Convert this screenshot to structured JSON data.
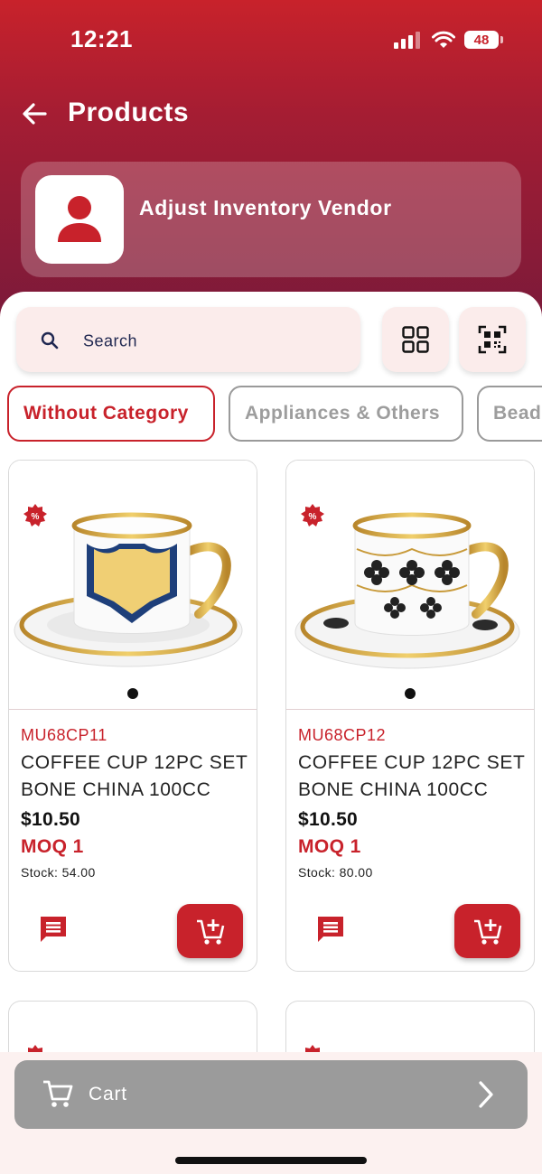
{
  "status": {
    "time": "12:21",
    "battery": "48"
  },
  "header": {
    "title": "Products",
    "back_icon": "arrow-left-icon"
  },
  "vendor": {
    "name": "Adjust Inventory Vendor",
    "avatar_icon": "person-icon"
  },
  "search": {
    "placeholder": "Search"
  },
  "toolbar": {
    "grid_icon": "grid-view-icon",
    "qr_icon": "qr-scan-icon"
  },
  "categories": [
    {
      "label": "Without Category",
      "active": true
    },
    {
      "label": "Appliances & Others",
      "active": false
    },
    {
      "label": "Bead",
      "active": false
    }
  ],
  "products": [
    {
      "sku": "MU68CP11",
      "name": "COFFEE CUP 12PC SET BONE CHINA 100CC",
      "price": "$10.50",
      "moq": "MOQ 1",
      "stock": "Stock: 54.00"
    },
    {
      "sku": "MU68CP12",
      "name": "COFFEE CUP 12PC SET BONE CHINA 100CC",
      "price": "$10.50",
      "moq": "MOQ 1",
      "stock": "Stock: 80.00"
    }
  ],
  "cart": {
    "label": "Cart"
  },
  "colors": {
    "primary": "#c8222b",
    "header_dark": "#7a1a3a",
    "cart_bar": "#9b9b9b",
    "chip_bg": "#fbeceb"
  }
}
